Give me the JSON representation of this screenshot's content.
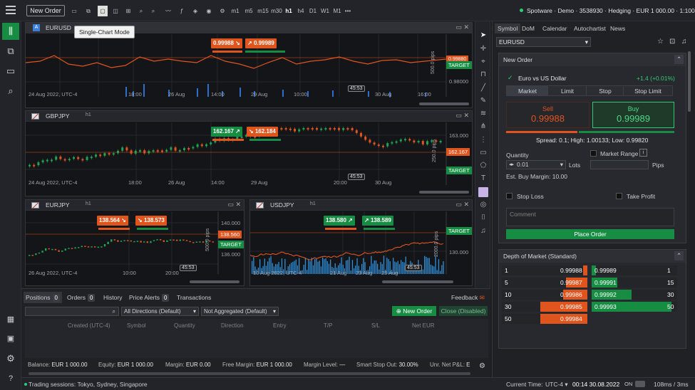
{
  "toolbar": {
    "new_order": "New Order",
    "timeframes": [
      "m1",
      "m5",
      "m15",
      "m30",
      "h1",
      "h4",
      "D1",
      "W1",
      "M1"
    ],
    "more": "•••"
  },
  "status_right": {
    "spotware": "Spotware · Demo · 3538930 · Hedging · EUR 1 000.00 · 1:100"
  },
  "tooltip": "Single-Chart Mode",
  "charts": {
    "eurusd": {
      "symbol": "EURUSD",
      "sell": "0.99988",
      "buy": "0.99989",
      "pips_label": "500.0 pips",
      "y1": "0.99880",
      "y2": "0.98000",
      "target": "TARGET",
      "x_labels": [
        "24 Aug 2022, UTC-4",
        "18:00",
        "26 Aug",
        "14:00",
        "29 Aug",
        "10:00",
        "30 Aug",
        "16:00"
      ],
      "timer": "45:53"
    },
    "gbpjpy": {
      "symbol": "GBPJPY",
      "tf": "h1",
      "sell": "162.167",
      "buy": "162.184",
      "pips_label": "250.0 pips",
      "y1": "163.000",
      "y2": "162.167",
      "y3": "162.000",
      "target": "TARGET",
      "x_labels": [
        "24 Aug 2022, UTC-4",
        "18:00",
        "26 Aug",
        "14:00",
        "29 Aug",
        "20:00",
        "30 Aug"
      ],
      "timer": "45:53"
    },
    "eurjpy": {
      "symbol": "EURJPY",
      "tf": "h1",
      "sell": "138.564",
      "buy": "138.573",
      "pips_label": "500.0 pips",
      "y1": "140.000",
      "y2": "138.560",
      "y3": "136.000",
      "target": "TARGET",
      "x_labels": [
        "26 Aug 2022, UTC-4",
        "10:00",
        "20:00"
      ],
      "timer": "45:53"
    },
    "usdjpy": {
      "symbol": "USDJPY",
      "tf": "h1",
      "sell": "138.580",
      "buy": "138.589",
      "pips_label": "2000.0 pips",
      "y1": "130.000",
      "target": "TARGET",
      "x_labels": [
        "10 Aug 2022, UTC-4",
        "21 Aug",
        "23 Aug",
        "25 Aug"
      ],
      "timer": "45:53"
    }
  },
  "bottom": {
    "tabs": [
      {
        "label": "Positions",
        "count": "0"
      },
      {
        "label": "Orders",
        "count": "0"
      },
      {
        "label": "History"
      },
      {
        "label": "Price Alerts",
        "count": "0"
      },
      {
        "label": "Transactions"
      }
    ],
    "feedback": "Feedback",
    "filter1": "All Directions (Default)",
    "filter2": "Not Aggregated (Default)",
    "new_order": "New Order",
    "close": "Close (Disabled)",
    "columns": [
      "Created (UTC-4)",
      "Symbol",
      "Quantity",
      "Direction",
      "Entry",
      "T/P",
      "S/L",
      "Net EUR"
    ],
    "balance": [
      {
        "k": "Balance:",
        "v": "EUR 1 000.00"
      },
      {
        "k": "Equity:",
        "v": "EUR 1 000.00"
      },
      {
        "k": "Margin:",
        "v": "EUR 0.00"
      },
      {
        "k": "Free Margin:",
        "v": "EUR 1 000.00"
      },
      {
        "k": "Margin Level:",
        "v": "—"
      },
      {
        "k": "Smart Stop Out:",
        "v": "30.00%"
      },
      {
        "k": "Unr. Net P&L:",
        "v": "E"
      }
    ]
  },
  "status": {
    "sessions": "Trading sessions: Tokyo, Sydney, Singapore",
    "current_time_label": "Current Time:",
    "tz": "UTC-4",
    "time": "00:14 30.08.2022",
    "on": "ON",
    "latency": "108ms / 3ms"
  },
  "right": {
    "tabs": [
      "Symbol",
      "DoM",
      "Calendar",
      "Autochartist",
      "News"
    ],
    "symbol": "EURUSD",
    "new_order": "New Order",
    "instrument": "Euro vs US Dollar",
    "change": "+1.4 (+0.01%)",
    "order_types": [
      "Market",
      "Limit",
      "Stop",
      "Stop Limit"
    ],
    "sell_label": "Sell",
    "sell_price": "0.99988",
    "buy_label": "Buy",
    "buy_price": "0.99989",
    "spread": "Spread: 0.1; High: 1.00133; Low: 0.99820",
    "quantity_label": "Quantity",
    "market_range": "Market Range",
    "quantity": "0.01",
    "lots": "Lots",
    "pips": "Pips",
    "margin": "Est. Buy Margin: 10.00",
    "stop_loss": "Stop Loss",
    "take_profit": "Take Profit",
    "comment_placeholder": "Comment",
    "place_order": "Place Order",
    "dom_title": "Depth of Market (Standard)",
    "dom_rows": [
      {
        "vol": "1",
        "sell": "0.99988",
        "buy": "0.99989",
        "bvol": "1"
      },
      {
        "vol": "5",
        "sell": "0.99987",
        "buy": "0.99991",
        "bvol": "15"
      },
      {
        "vol": "10",
        "sell": "0.99986",
        "buy": "0.99992",
        "bvol": "30"
      },
      {
        "vol": "30",
        "sell": "0.99985",
        "buy": "0.99993",
        "bvol": "50"
      },
      {
        "vol": "50",
        "sell": "0.99984",
        "buy": "",
        "bvol": ""
      }
    ]
  }
}
